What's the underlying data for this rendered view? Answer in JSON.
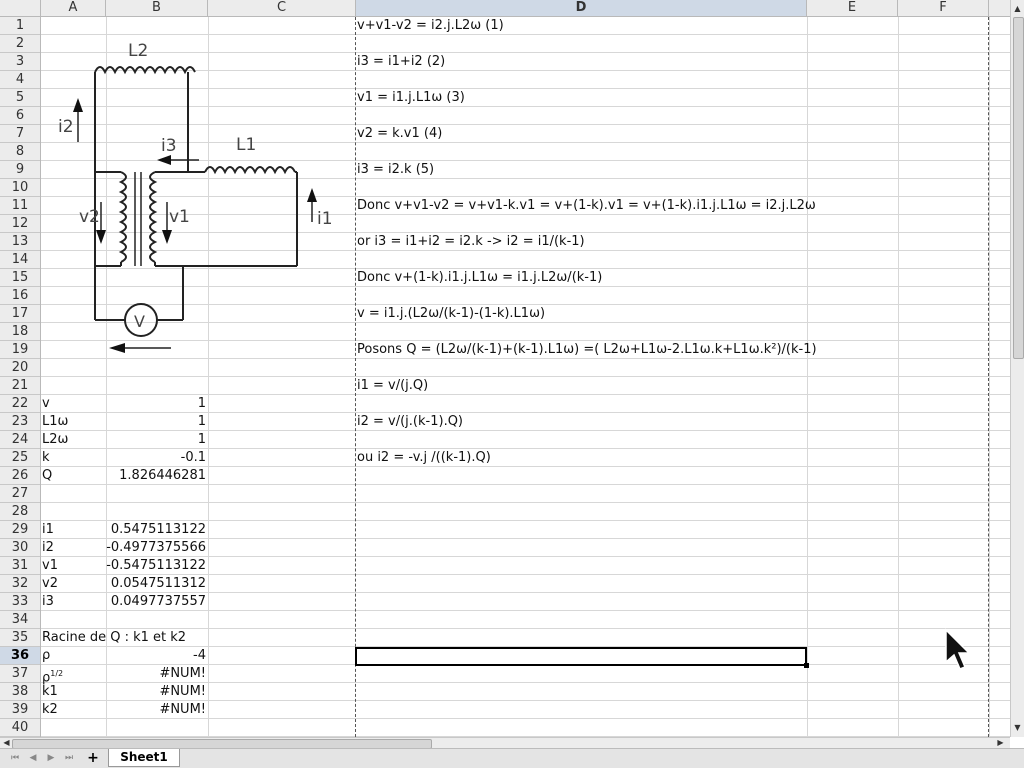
{
  "columns": [
    "A",
    "B",
    "C",
    "D",
    "E",
    "F"
  ],
  "selected_column": "D",
  "selected_row": 36,
  "rows": [
    1,
    2,
    3,
    4,
    5,
    6,
    7,
    8,
    9,
    10,
    11,
    12,
    13,
    14,
    15,
    16,
    17,
    18,
    19,
    20,
    21,
    22,
    23,
    24,
    25,
    26,
    27,
    28,
    29,
    30,
    31,
    32,
    33,
    34,
    35,
    36,
    37,
    38,
    39,
    40
  ],
  "equations": {
    "r1": "v+v1-v2 = i2.j.L2ω  (1)",
    "r3": "i3 = i1+i2    (2)",
    "r5": "v1 = i1.j.L1ω    (3)",
    "r7": "v2 = k.v1    (4)",
    "r9": "i3 = i2.k    (5)",
    "r11": "Donc v+v1-v2 = v+v1-k.v1 = v+(1-k).v1 = v+(1-k).i1.j.L1ω = i2.j.L2ω",
    "r13": "or i3 = i1+i2 = i2.k -> i2 = i1/(k-1)",
    "r15": "Donc v+(1-k).i1.j.L1ω = i1.j.L2ω/(k-1)",
    "r17": "v = i1.j.(L2ω/(k-1)-(1-k).L1ω)",
    "r19": "Posons Q = (L2ω/(k-1)+(k-1).L1ω) =( L2ω+L1ω-2.L1ω.k+L1ω.k²)/(k-1)",
    "r21": "i1 = v/(j.Q)",
    "r23": "i2 = v/(j.(k-1).Q)",
    "r25": "ou i2 = -v.j /((k-1).Q)"
  },
  "params": {
    "r22": {
      "a": "v",
      "b": "1"
    },
    "r23": {
      "a": "L1ω",
      "b": "1"
    },
    "r24": {
      "a": "L2ω",
      "b": "1"
    },
    "r25": {
      "a": "k",
      "b": "-0.1"
    },
    "r26": {
      "a": "Q",
      "b": "1.826446281"
    }
  },
  "results": {
    "r29": {
      "a": "i1",
      "b": "0.5475113122"
    },
    "r30": {
      "a": "i2",
      "b": "-0.4977375566"
    },
    "r31": {
      "a": "v1",
      "b": "-0.5475113122"
    },
    "r32": {
      "a": "v2",
      "b": "0.0547511312"
    },
    "r33": {
      "a": "i3",
      "b": "0.0497737557"
    }
  },
  "roots": {
    "r35": {
      "a": "Racine de Q : k1 et k2"
    },
    "r36": {
      "a": "ρ",
      "b": "-4"
    },
    "r37": {
      "a": "ρ",
      "sup": "1/2",
      "b": "#NUM!"
    },
    "r38": {
      "a": "k1",
      "b": "#NUM!"
    },
    "r39": {
      "a": "k2",
      "b": "#NUM!"
    }
  },
  "circuit": {
    "labels": {
      "L2": "L2",
      "L1": "L1",
      "i2": "i2",
      "i3": "i3",
      "i1": "i1",
      "v2": "v2",
      "v1": "v1",
      "V": "V"
    }
  },
  "sheet_tab": "Sheet1",
  "add_sheet_symbol": "+",
  "colors": {
    "header_bg": "#ececec",
    "selected_header": "#cfd9e6",
    "grid_line": "#d7d7d7"
  }
}
